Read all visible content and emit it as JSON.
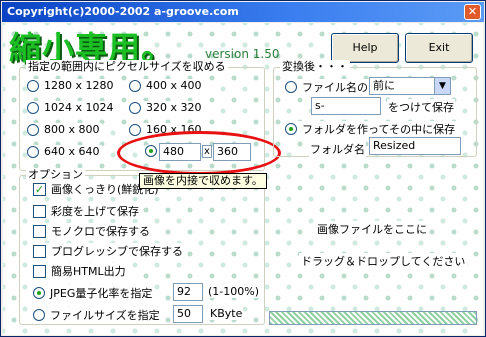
{
  "window": {
    "title": "Copyright(c)2000-2002 a-groove.com",
    "close_label": "✕"
  },
  "logo": {
    "text": "縮小専用。",
    "version": "version 1.50"
  },
  "buttons": {
    "help": "Help",
    "exit": "Exit"
  },
  "size_group": {
    "label": "指定の範囲内にピクセルサイズを収める",
    "options": [
      "1280 x 1280",
      "400 x 400",
      "1024 x 1024",
      "320 x 320",
      "800 x 800",
      "160 x 160",
      "640 x 640"
    ],
    "selected": "custom",
    "custom_width": "480",
    "custom_sep": "x",
    "custom_height": "360",
    "tooltip": "画像を内接で収めます。"
  },
  "after_group": {
    "label": "変換後・・・",
    "filename_option": "ファイル名の",
    "filename_select": "前に",
    "suffix_value": "s-",
    "suffix_after": "をつけて保存",
    "folder_option": "フォルダを作ってその中に保存",
    "folder_label": "フォルダ名",
    "folder_value": "Resized",
    "selected": "folder"
  },
  "options_group": {
    "label": "オプション",
    "items": [
      {
        "label": "画像くっきり(鮮鋭化)",
        "checked": true
      },
      {
        "label": "彩度を上げて保存",
        "checked": false
      },
      {
        "label": "モノクロで保存する",
        "checked": false
      },
      {
        "label": "プログレッシブで保存する",
        "checked": false
      },
      {
        "label": "簡易HTML出力",
        "checked": false
      }
    ],
    "jpeg_label": "JPEG量子化率を指定",
    "jpeg_value": "92",
    "jpeg_range": "(1-100%)",
    "filesize_label": "ファイルサイズを指定",
    "filesize_value": "50",
    "filesize_unit": "KByte"
  },
  "dropzone": {
    "line1": "画像ファイルをここに",
    "line2": "ドラッグ＆ドロップしてください"
  },
  "colors": {
    "logo": "#1bbf23",
    "title": "#0a44c4",
    "highlight": "#e81010"
  }
}
